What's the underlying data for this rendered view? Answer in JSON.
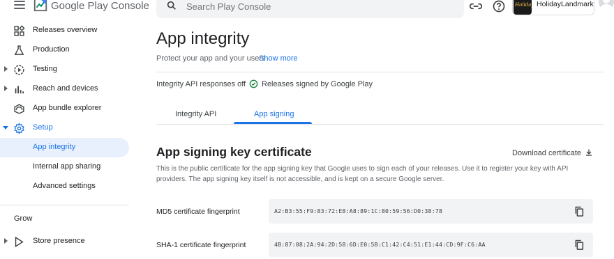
{
  "header": {
    "brand": "Google Play Console",
    "search_placeholder": "Search Play Console",
    "account_name": "HolidayLandmark",
    "account_logo_text": "Holiday"
  },
  "sidebar": {
    "items": [
      {
        "label": "Releases overview",
        "icon": "dashboard-icon"
      },
      {
        "label": "Production",
        "icon": "flask-icon"
      },
      {
        "label": "Testing",
        "icon": "play-circle-icon",
        "expandable": true
      },
      {
        "label": "Reach and devices",
        "icon": "bar-chart-icon",
        "expandable": true
      },
      {
        "label": "App bundle explorer",
        "icon": "bundle-icon"
      },
      {
        "label": "Setup",
        "icon": "gear-icon",
        "expanded": true
      },
      {
        "label": "App integrity",
        "active": true
      },
      {
        "label": "Internal app sharing"
      },
      {
        "label": "Advanced settings"
      }
    ],
    "section_grow": "Grow",
    "store_presence": "Store presence"
  },
  "main": {
    "title": "App integrity",
    "subtitle": "Protect your app and your users",
    "show_more": "Show more",
    "status_api": "Integrity API responses off",
    "status_dot": "·",
    "status_signed": "Releases signed by Google Play",
    "tabs": [
      {
        "label": "Integrity API",
        "selected": false
      },
      {
        "label": "App signing",
        "selected": true
      }
    ],
    "section_title": "App signing key certificate",
    "download_label": "Download certificate",
    "description": "This is the public certificate for the app signing key that Google uses to sign each of your releases. Use it to register your key with API providers. The app signing key itself is not accessible, and is kept on a secure Google server.",
    "fingerprints": [
      {
        "label": "MD5 certificate fingerprint",
        "value": "A2:B3:55:F9:83:72:E8:A8:89:1C:80:59:56:D0:38:78"
      },
      {
        "label": "SHA-1 certificate fingerprint",
        "value": "4B:87:08:2A:94:2D:58:6D:E0:5B:C1:42:C4:51:E1:44:CD:9F:C6:AA"
      }
    ]
  },
  "colors": {
    "accent": "#1a73e8",
    "active_bg": "#e8f0fe",
    "success": "#188038",
    "text_secondary": "#5f6368"
  }
}
